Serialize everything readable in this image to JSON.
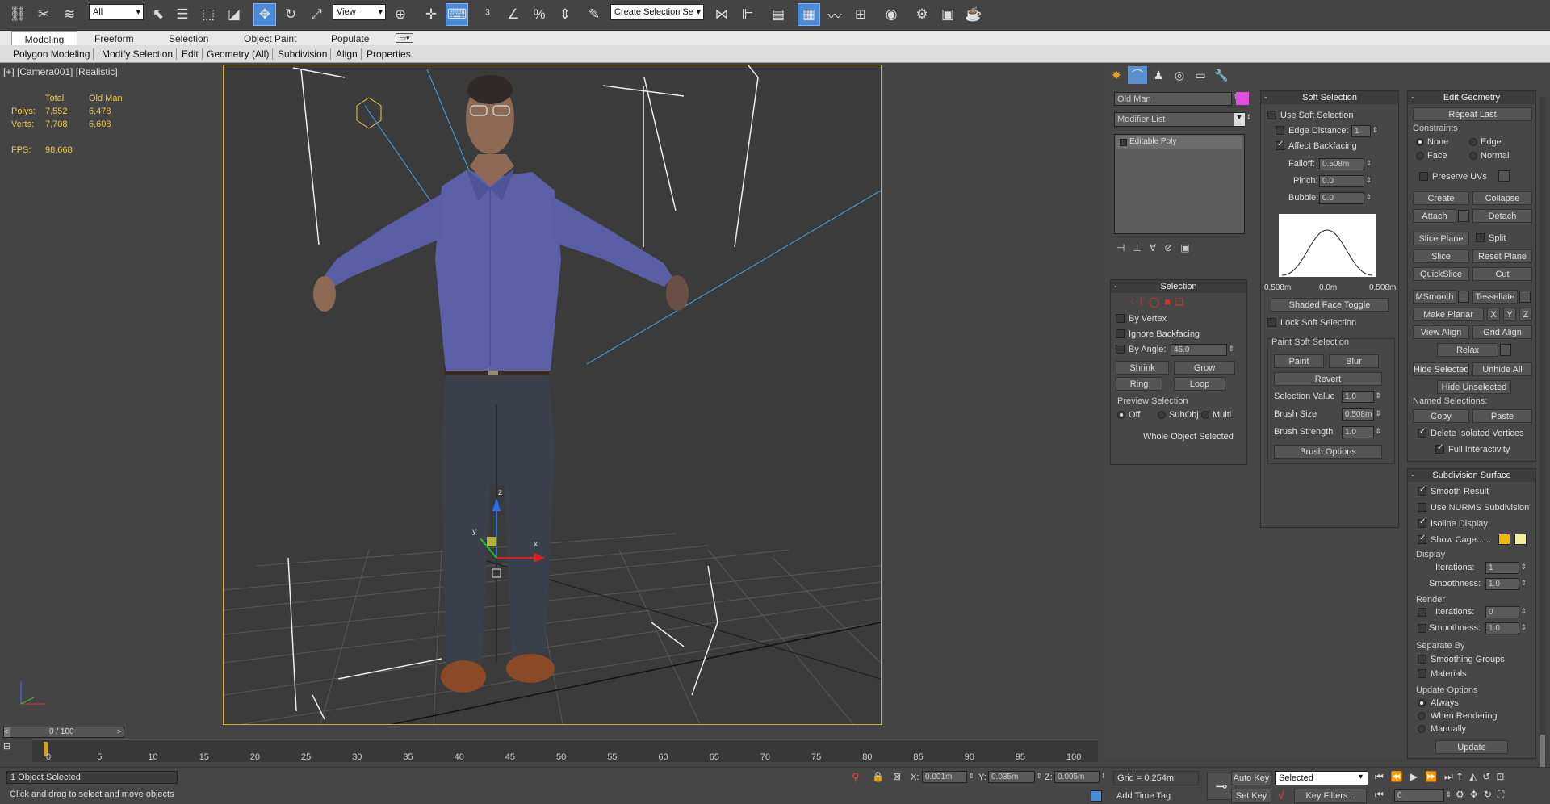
{
  "toolbar": {
    "filter_select": "All",
    "ref_coord_select": "View",
    "named_selection": "Create Selection Se"
  },
  "ribbon": {
    "tabs": [
      "Modeling",
      "Freeform",
      "Selection",
      "Object Paint",
      "Populate"
    ],
    "active_tab": "Modeling",
    "sub_items": [
      "Polygon Modeling",
      "Modify Selection",
      "Edit",
      "Geometry (All)",
      "Subdivision",
      "Align",
      "Properties"
    ]
  },
  "viewport": {
    "label": "[+] [Camera001] [Realistic]",
    "stats": {
      "header_total": "Total",
      "header_object": "Old Man",
      "polys_label": "Polys:",
      "polys_total": "7,552",
      "polys_object": "6,478",
      "verts_label": "Verts:",
      "verts_total": "7,708",
      "verts_object": "6,608",
      "fps_label": "FPS:",
      "fps_value": "98.668"
    },
    "gizmo_x": "x",
    "gizmo_y": "y",
    "gizmo_z": "z"
  },
  "command_panel": {
    "object_name": "Old Man",
    "object_color": "#e04ee0",
    "modifier_list": "Modifier List",
    "stack_item": "Editable Poly",
    "selection": {
      "title": "Selection",
      "by_vertex": "By Vertex",
      "ignore_backfacing": "Ignore Backfacing",
      "by_angle": "By Angle:",
      "angle_value": "45.0",
      "shrink": "Shrink",
      "grow": "Grow",
      "ring": "Ring",
      "loop": "Loop",
      "preview_selection": "Preview Selection",
      "off": "Off",
      "subobj": "SubObj",
      "multi": "Multi",
      "status": "Whole Object Selected"
    },
    "soft": {
      "title": "Soft Selection",
      "use_soft": "Use Soft Selection",
      "edge_distance": "Edge Distance:",
      "edge_distance_value": "1",
      "affect_backfacing": "Affect Backfacing",
      "falloff": "Falloff:",
      "falloff_value": "0.508m",
      "pinch": "Pinch:",
      "pinch_value": "0.0",
      "bubble": "Bubble:",
      "bubble_value": "0.0",
      "curve_left": "0.508m",
      "curve_mid": "0.0m",
      "curve_right": "0.508m",
      "shaded_face_toggle": "Shaded Face Toggle",
      "lock_soft": "Lock Soft Selection",
      "paint_soft": "Paint Soft Selection",
      "paint": "Paint",
      "blur": "Blur",
      "revert": "Revert",
      "selection_value": "Selection Value",
      "selection_value_num": "1.0",
      "brush_size": "Brush Size",
      "brush_size_num": "0.508m",
      "brush_strength": "Brush Strength",
      "brush_strength_num": "1.0",
      "brush_options": "Brush Options"
    },
    "edit_geometry": {
      "title": "Edit Geometry",
      "repeat_last": "Repeat Last",
      "constraints": "Constraints",
      "none": "None",
      "edge": "Edge",
      "face": "Face",
      "normal": "Normal",
      "preserve_uvs": "Preserve UVs",
      "create": "Create",
      "collapse": "Collapse",
      "attach": "Attach",
      "detach": "Detach",
      "slice_plane": "Slice Plane",
      "split": "Split",
      "slice": "Slice",
      "reset_plane": "Reset Plane",
      "quickslice": "QuickSlice",
      "cut": "Cut",
      "msmooth": "MSmooth",
      "tessellate": "Tessellate",
      "make_planar": "Make Planar",
      "x": "X",
      "y": "Y",
      "z": "Z",
      "view_align": "View Align",
      "grid_align": "Grid Align",
      "relax": "Relax",
      "hide_selected": "Hide Selected",
      "unhide_all": "Unhide All",
      "hide_unselected": "Hide Unselected",
      "named_selections": "Named Selections:",
      "copy": "Copy",
      "paste": "Paste",
      "delete_isolated": "Delete Isolated Vertices",
      "full_interactivity": "Full Interactivity"
    },
    "subdivision": {
      "title": "Subdivision Surface",
      "smooth_result": "Smooth Result",
      "use_nurms": "Use NURMS Subdivision",
      "isoline": "Isoline Display",
      "show_cage": "Show Cage......",
      "cage_color_1": "#f0b800",
      "cage_color_2": "#f4ee9a",
      "display": "Display",
      "iterations": "Iterations:",
      "iterations_value": "1",
      "smoothness": "Smoothness:",
      "smoothness_value": "1.0",
      "render": "Render",
      "render_iterations_value": "0",
      "render_smoothness_value": "1.0",
      "separate_by": "Separate By",
      "smoothing_groups": "Smoothing Groups",
      "materials": "Materials",
      "update_options": "Update Options",
      "always": "Always",
      "when_rendering": "When Rendering",
      "manually": "Manually",
      "update": "Update"
    }
  },
  "timeline": {
    "frame": "0 / 100",
    "ticks": [
      "0",
      "5",
      "10",
      "15",
      "20",
      "25",
      "30",
      "35",
      "40",
      "45",
      "50",
      "55",
      "60",
      "65",
      "70",
      "75",
      "80",
      "85",
      "90",
      "95",
      "100"
    ]
  },
  "status": {
    "selected": "1 Object Selected",
    "prompt": "Click and drag to select and move objects",
    "x_label": "X:",
    "x_value": "0.001m",
    "y_label": "Y:",
    "y_value": "0.035m",
    "z_label": "Z:",
    "z_value": "0.005m",
    "grid": "Grid = 0.254m",
    "add_time_tag": "Add Time Tag",
    "auto_key": "Auto Key",
    "set_key": "Set Key",
    "key_mode": "Selected",
    "key_filters": "Key Filters...",
    "frame_field": "0"
  }
}
